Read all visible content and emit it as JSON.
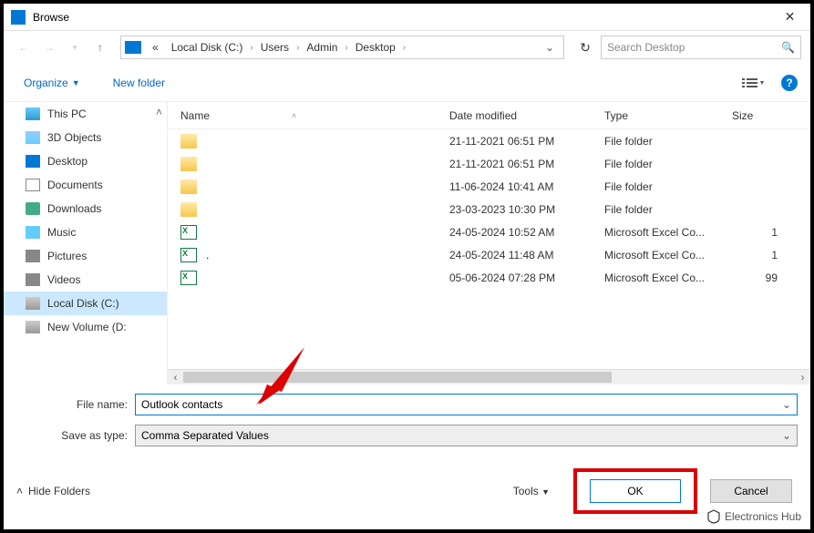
{
  "window": {
    "title": "Browse"
  },
  "breadcrumb": {
    "drive_prefix": "«",
    "segments": [
      "Local Disk (C:)",
      "Users",
      "Admin",
      "Desktop"
    ],
    "search_placeholder": "Search Desktop"
  },
  "toolbar": {
    "organize": "Organize",
    "newfolder": "New folder"
  },
  "tree": {
    "items": [
      {
        "label": "This PC",
        "icon": "ti-pc"
      },
      {
        "label": "3D Objects",
        "icon": "ti-3d"
      },
      {
        "label": "Desktop",
        "icon": "ti-desk"
      },
      {
        "label": "Documents",
        "icon": "ti-doc"
      },
      {
        "label": "Downloads",
        "icon": "ti-down"
      },
      {
        "label": "Music",
        "icon": "ti-music"
      },
      {
        "label": "Pictures",
        "icon": "ti-pic"
      },
      {
        "label": "Videos",
        "icon": "ti-vid"
      },
      {
        "label": "Local Disk (C:)",
        "icon": "ti-disk",
        "selected": true
      },
      {
        "label": "New Volume (D:",
        "icon": "ti-disk"
      }
    ]
  },
  "columns": {
    "name": "Name",
    "date": "Date modified",
    "type": "Type",
    "size": "Size"
  },
  "files": [
    {
      "name": "",
      "date": "21-11-2021 06:51 PM",
      "type": "File folder",
      "size": "",
      "icon": "fi-folder"
    },
    {
      "name": "",
      "date": "21-11-2021 06:51 PM",
      "type": "File folder",
      "size": "",
      "icon": "fi-folder"
    },
    {
      "name": "",
      "date": "11-06-2024 10:41 AM",
      "type": "File folder",
      "size": "",
      "icon": "fi-folder"
    },
    {
      "name": "",
      "date": "23-03-2023 10:30 PM",
      "type": "File folder",
      "size": "",
      "icon": "fi-folder"
    },
    {
      "name": "",
      "date": "24-05-2024 10:52 AM",
      "type": "Microsoft Excel Co...",
      "size": "1",
      "icon": "fi-excel"
    },
    {
      "name": ".",
      "date": "24-05-2024 11:48 AM",
      "type": "Microsoft Excel Co...",
      "size": "1",
      "icon": "fi-excel"
    },
    {
      "name": "",
      "date": "05-06-2024 07:28 PM",
      "type": "Microsoft Excel Co...",
      "size": "99",
      "icon": "fi-excel"
    }
  ],
  "form": {
    "filename_label": "File name:",
    "filename_value": "Outlook contacts",
    "saveas_label": "Save as type:",
    "saveas_value": "Comma Separated Values"
  },
  "footer": {
    "hide_folders": "Hide Folders",
    "tools": "Tools",
    "ok": "OK",
    "cancel": "Cancel"
  },
  "watermark": "Electronics Hub"
}
